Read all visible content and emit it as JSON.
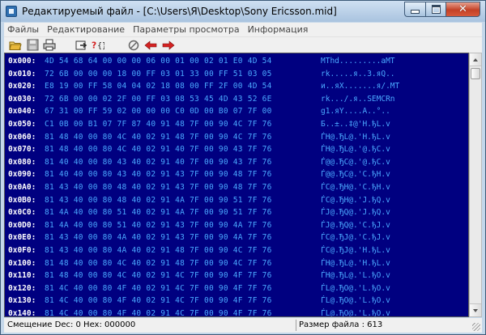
{
  "window": {
    "title": "Редактируемый файл - [C:\\Users\\Я\\Desktop\\Sony Ericsson.mid]"
  },
  "menu": [
    {
      "label": "Файлы"
    },
    {
      "label": "Редактирование"
    },
    {
      "label": "Параметры просмотра"
    },
    {
      "label": "Информация"
    }
  ],
  "toolbar": {
    "icons": [
      "open-folder-icon",
      "save-disk-icon",
      "print-icon",
      "goto-icon",
      "find-icon",
      "cancel-icon",
      "back-arrow-icon",
      "forward-arrow-icon"
    ],
    "accent_red": "#d42222",
    "folder_yellow": "#e8c040"
  },
  "hex_view": {
    "background": "#000080",
    "address_color": "#ffffff",
    "byte_color": "#4aa8ff",
    "rows": [
      {
        "addr": "0x000:",
        "hex": "4D 54 68 64 00 00 00 06 00 01 00 02 01 E0 4D 54",
        "ascii": "MThd.........аMT"
      },
      {
        "addr": "0x010:",
        "hex": "72 6B 00 00 00 18 00 FF 03 01 33 00 FF 51 03 05",
        "ascii": "rk.....я..3.яQ.."
      },
      {
        "addr": "0x020:",
        "hex": "E8 19 00 FF 58 04 04 02 18 08 00 FF 2F 00 4D 54",
        "ascii": "и..яX.......я/.MT"
      },
      {
        "addr": "0x030:",
        "hex": "72 6B 00 00 02 2F 00 FF 03 08 53 45 4D 43 52 6E",
        "ascii": "rk.../.я..SEMCRn"
      },
      {
        "addr": "0x040:",
        "hex": "67 31 00 FF 59 02 00 00 00 C0 0D 00 B0 07 7F 00",
        "ascii": "g1.яY....А..°.."
      },
      {
        "addr": "0x050:",
        "hex": "C1 0B 00 B1 07 7F 87 40 91 48 7F 00 90 4C 7F 76",
        "ascii": "Б..±..‡@'H.ђL.v"
      },
      {
        "addr": "0x060:",
        "hex": "81 48 40 00 80 4C 40 02 91 48 7F 00 90 4C 7F 76",
        "ascii": "ЃH@.ЂL@.'H.ђL.v"
      },
      {
        "addr": "0x070:",
        "hex": "81 48 40 00 80 4C 40 02 91 40 7F 00 90 43 7F 76",
        "ascii": "ЃH@.ЂL@.'@.ђC.v"
      },
      {
        "addr": "0x080:",
        "hex": "81 40 40 00 80 43 40 02 91 40 7F 00 90 43 7F 76",
        "ascii": "Ѓ@@.ЂC@.'@.ђC.v"
      },
      {
        "addr": "0x090:",
        "hex": "81 40 40 00 80 43 40 02 91 43 7F 00 90 48 7F 76",
        "ascii": "Ѓ@@.ЂC@.'C.ђH.v"
      },
      {
        "addr": "0x0A0:",
        "hex": "81 43 40 00 80 48 40 02 91 43 7F 00 90 48 7F 76",
        "ascii": "ЃC@.ЂH@.'C.ђH.v"
      },
      {
        "addr": "0x0B0:",
        "hex": "81 43 40 00 80 48 40 02 91 4A 7F 00 90 51 7F 76",
        "ascii": "ЃC@.ЂH@.'J.ђQ.v"
      },
      {
        "addr": "0x0C0:",
        "hex": "81 4A 40 00 80 51 40 02 91 4A 7F 00 90 51 7F 76",
        "ascii": "ЃJ@.ЂQ@.'J.ђQ.v"
      },
      {
        "addr": "0x0D0:",
        "hex": "81 4A 40 00 80 51 40 02 91 43 7F 00 90 4A 7F 76",
        "ascii": "ЃJ@.ЂQ@.'C.ђJ.v"
      },
      {
        "addr": "0x0E0:",
        "hex": "81 43 40 00 80 4A 40 02 91 43 7F 00 90 4A 7F 76",
        "ascii": "ЃC@.ЂJ@.'C.ђJ.v"
      },
      {
        "addr": "0x0F0:",
        "hex": "81 43 40 00 80 4A 40 02 91 48 7F 00 90 4C 7F 76",
        "ascii": "ЃC@.ЂJ@.'H.ђL.v"
      },
      {
        "addr": "0x100:",
        "hex": "81 48 40 00 80 4C 40 02 91 48 7F 00 90 4C 7F 76",
        "ascii": "ЃH@.ЂL@.'H.ђL.v"
      },
      {
        "addr": "0x110:",
        "hex": "81 48 40 00 80 4C 40 02 91 4C 7F 00 90 4F 7F 76",
        "ascii": "ЃH@.ЂL@.'L.ђO.v"
      },
      {
        "addr": "0x120:",
        "hex": "81 4C 40 00 80 4F 40 02 91 4C 7F 00 90 4F 7F 76",
        "ascii": "ЃL@.ЂO@.'L.ђO.v"
      },
      {
        "addr": "0x130:",
        "hex": "81 4C 40 00 80 4F 40 02 91 4C 7F 00 90 4F 7F 76",
        "ascii": "ЃL@.ЂO@.'L.ђO.v"
      },
      {
        "addr": "0x140:",
        "hex": "81 4C 40 00 80 4F 40 02 91 4C 7F 00 90 4F 7F 76",
        "ascii": "ЃL@.ЂO@.'L.ђO.v"
      }
    ]
  },
  "status": {
    "offset": "Смещение Dec: 0 Hex: 000000",
    "file_size": "Размер файла : 613"
  }
}
